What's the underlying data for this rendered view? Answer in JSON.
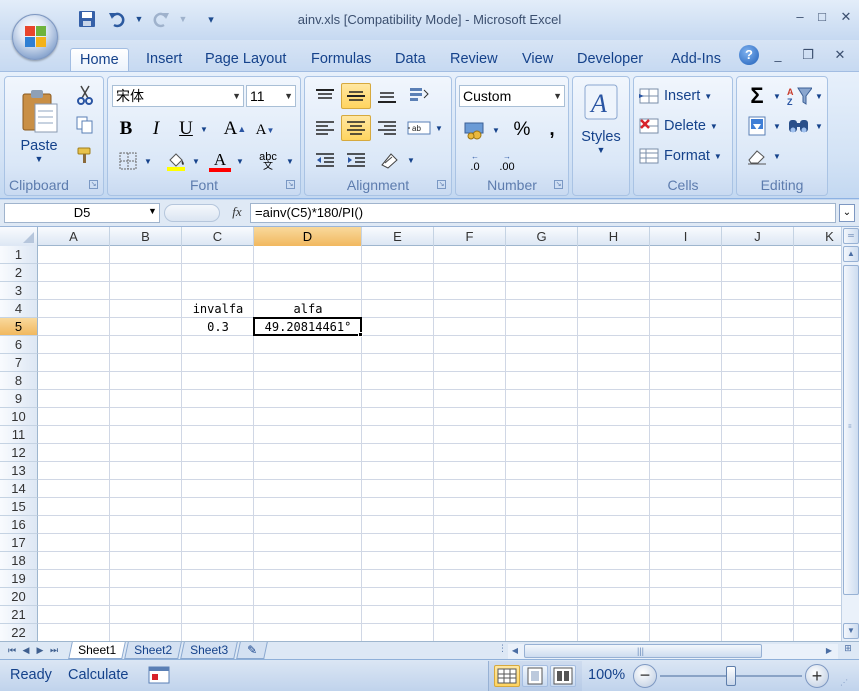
{
  "app": {
    "title": "ainv.xls  [Compatibility Mode] - Microsoft Excel"
  },
  "quick_access": {
    "icons": [
      "save-icon",
      "undo-icon",
      "redo-icon",
      "customize-icon"
    ]
  },
  "window_controls": {
    "min": "–",
    "max": "□",
    "close": "✕",
    "doc_min": "–",
    "doc_restore": "❐",
    "doc_close": "✕"
  },
  "tabs": [
    "Home",
    "Insert",
    "Page Layout",
    "Formulas",
    "Data",
    "Review",
    "View",
    "Developer",
    "Add-Ins"
  ],
  "active_tab": "Home",
  "ribbon": {
    "clipboard": {
      "label": "Clipboard",
      "paste": "Paste"
    },
    "font": {
      "label": "Font",
      "name": "宋体",
      "size": "11",
      "bold": "B",
      "italic": "I",
      "underline": "U",
      "grow": "A",
      "shrink": "A",
      "phonetic": "abc"
    },
    "alignment": {
      "label": "Alignment",
      "wrap": "ab"
    },
    "number": {
      "label": "Number",
      "format": "Custom",
      "percent": "%",
      "comma": ",",
      "inc_decimal": ".0",
      "dec_decimal": ".00"
    },
    "styles": {
      "label": "Styles"
    },
    "cells": {
      "label": "Cells",
      "insert": "Insert",
      "delete": "Delete",
      "format": "Format"
    },
    "editing": {
      "label": "Editing"
    }
  },
  "formula_bar": {
    "name_box": "D5",
    "fx": "fx",
    "formula": "=ainv(C5)*180/PI()"
  },
  "sheet": {
    "columns": [
      "A",
      "B",
      "C",
      "D",
      "E",
      "F",
      "G",
      "H",
      "I",
      "J",
      "K"
    ],
    "rows": [
      "1",
      "2",
      "3",
      "4",
      "5",
      "6",
      "7",
      "8",
      "9",
      "10",
      "11",
      "12",
      "13",
      "14",
      "15",
      "16",
      "17",
      "18",
      "19",
      "20",
      "21",
      "22"
    ],
    "active_column": "D",
    "active_row": "5",
    "cells": {
      "C4": "invalfa",
      "D4": "alfa",
      "C5": "0.3",
      "D5": "49.20814461°"
    }
  },
  "sheet_tabs": [
    "Sheet1",
    "Sheet2",
    "Sheet3"
  ],
  "active_sheet": "Sheet1",
  "status": {
    "mode": "Ready",
    "calc": "Calculate",
    "zoom": "100%",
    "zoom_level": 1.0
  }
}
